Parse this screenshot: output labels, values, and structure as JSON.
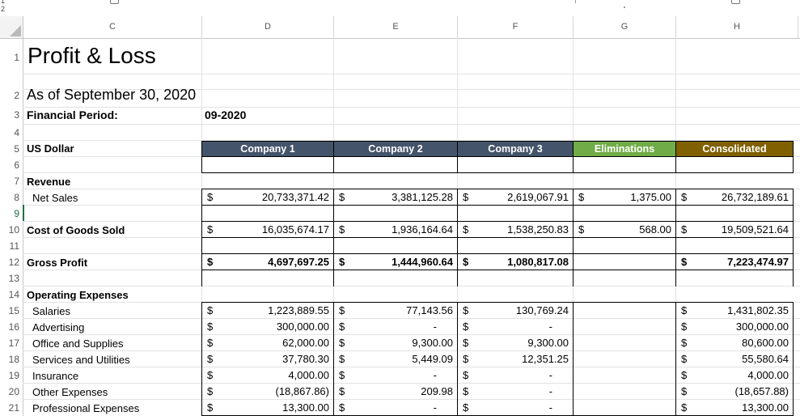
{
  "outline": {
    "levels": [
      "1",
      "2"
    ]
  },
  "columns": [
    "C",
    "D",
    "E",
    "F",
    "G",
    "H"
  ],
  "rows": [
    "1",
    "2",
    "3",
    "4",
    "5",
    "6",
    "7",
    "8",
    "9",
    "10",
    "11",
    "12",
    "13",
    "14",
    "15",
    "16",
    "17",
    "18",
    "19",
    "20",
    "21"
  ],
  "title": "Profit & Loss",
  "as_of": "As of September 30, 2020",
  "financial_period_label": "Financial Period:",
  "financial_period_value": "09-2020",
  "currency_label": "US Dollar",
  "headers": [
    {
      "label": "Company 1",
      "color": "#44546a"
    },
    {
      "label": "Company 2",
      "color": "#44546a"
    },
    {
      "label": "Company 3",
      "color": "#44546a"
    },
    {
      "label": "Eliminations",
      "color": "#70ad47"
    },
    {
      "label": "Consolidated",
      "color": "#806000"
    }
  ],
  "currency_symbol": "$",
  "lines": {
    "revenue": {
      "label": "Revenue"
    },
    "net_sales": {
      "label": "Net Sales",
      "values": [
        "20,733,371.42",
        "3,381,125.28",
        "2,619,067.91",
        "1,375.00",
        "26,732,189.61"
      ]
    },
    "cogs": {
      "label": "Cost of Goods Sold",
      "values": [
        "16,035,674.17",
        "1,936,164.64",
        "1,538,250.83",
        "568.00",
        "19,509,521.64"
      ]
    },
    "gross_profit": {
      "label": "Gross Profit",
      "values": [
        "4,697,697.25",
        "1,444,960.64",
        "1,080,817.08",
        "",
        "7,223,474.97"
      ]
    },
    "opex": {
      "label": "Operating Expenses"
    },
    "salaries": {
      "label": "Salaries",
      "values": [
        "1,223,889.55",
        "77,143.56",
        "130,769.24",
        "",
        "1,431,802.35"
      ]
    },
    "advertising": {
      "label": "Advertising",
      "values": [
        "300,000.00",
        "-",
        "-",
        "",
        "300,000.00"
      ]
    },
    "office": {
      "label": "Office and Supplies",
      "values": [
        "62,000.00",
        "9,300.00",
        "9,300.00",
        "",
        "80,600.00"
      ]
    },
    "services": {
      "label": "Services and Utilities",
      "values": [
        "37,780.30",
        "5,449.09",
        "12,351.25",
        "",
        "55,580.64"
      ]
    },
    "insurance": {
      "label": "Insurance",
      "values": [
        "4,000.00",
        "-",
        "-",
        "",
        "4,000.00"
      ]
    },
    "other": {
      "label": "Other Expenses",
      "values": [
        "(18,867.86)",
        "209.98",
        "-",
        "",
        "(18,657.88)"
      ]
    },
    "professional": {
      "label": "Professional Expenses",
      "values": [
        "13,300.00",
        "-",
        "-",
        "",
        "13,300.00"
      ]
    }
  }
}
